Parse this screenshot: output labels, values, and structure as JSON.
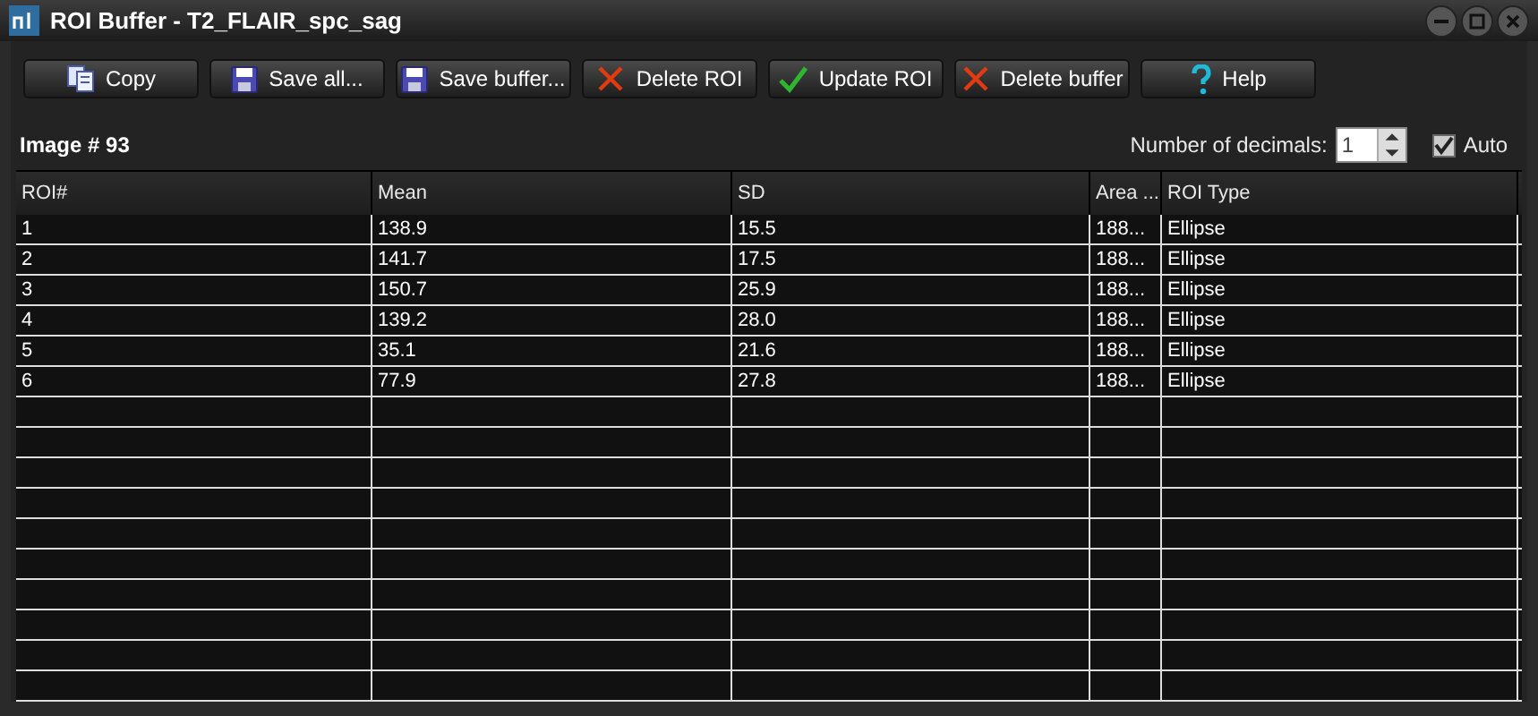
{
  "window": {
    "title": "ROI Buffer - T2_FLAIR_spc_sag"
  },
  "toolbar": [
    "Copy",
    "Save all...",
    "Save buffer...",
    "Delete ROI",
    "Update ROI",
    "Delete buffer",
    "Help"
  ],
  "image_label": "Image # 93",
  "decimals": {
    "label": "Number of decimals:",
    "value": "1"
  },
  "auto": {
    "label": "Auto",
    "checked": true
  },
  "table": {
    "columns": [
      "ROI#",
      "Mean",
      "SD",
      "Area ...",
      "ROI Type"
    ],
    "rows": [
      [
        "1",
        "138.9",
        "15.5",
        "188...",
        "Ellipse"
      ],
      [
        "2",
        "141.7",
        "17.5",
        "188...",
        "Ellipse"
      ],
      [
        "3",
        "150.7",
        "25.9",
        "188...",
        "Ellipse"
      ],
      [
        "4",
        "139.2",
        "28.0",
        "188...",
        "Ellipse"
      ],
      [
        "5",
        "35.1",
        "21.6",
        "188...",
        "Ellipse"
      ],
      [
        "6",
        "77.9",
        "27.8",
        "188...",
        "Ellipse"
      ]
    ]
  }
}
